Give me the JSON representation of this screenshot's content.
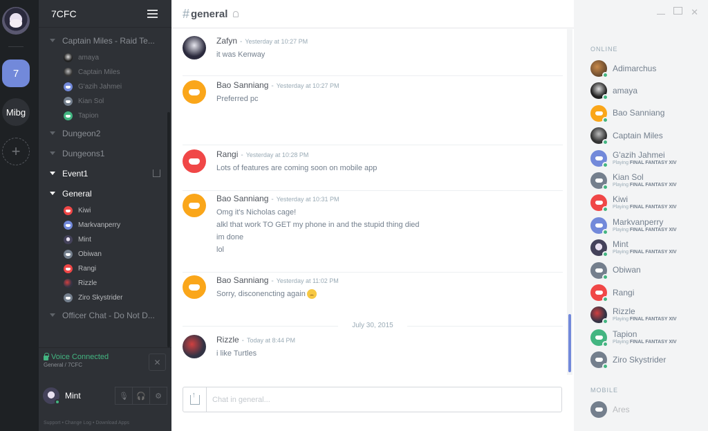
{
  "guilds": [
    {
      "id": "avatar",
      "label": ""
    },
    {
      "id": "7",
      "label": "7"
    },
    {
      "id": "mibg",
      "label": "Mibg"
    },
    {
      "id": "add",
      "label": "+"
    }
  ],
  "server": {
    "name": "7CFC"
  },
  "channels": {
    "captain": {
      "label": "Captain Miles - Raid Te...",
      "users": [
        "amaya",
        "Captain Miles",
        "G'azih Jahmei",
        "Kian Sol",
        "Tapion"
      ]
    },
    "dungeon2": {
      "label": "Dungeon2"
    },
    "dungeons1": {
      "label": "Dungeons1"
    },
    "event1": {
      "label": "Event1"
    },
    "general": {
      "label": "General",
      "users": [
        "Kiwi",
        "Markvanperry",
        "Mint",
        "Obiwan",
        "Rangi",
        "Rizzle",
        "Ziro Skystrider"
      ]
    },
    "officer": {
      "label": "Officer Chat - Do Not D..."
    }
  },
  "voice": {
    "status": "Voice Connected",
    "channel": "General / 7CFC"
  },
  "user": {
    "name": "Mint"
  },
  "footer": {
    "links": "Support  •  Change Log  •  Download Apps"
  },
  "chat": {
    "hash": "#",
    "channel": "general",
    "messages": [
      {
        "author": "Zafyn",
        "time": "Yesterday at 10:27 PM",
        "lines": [
          "it was Kenway"
        ]
      },
      {
        "author": "Bao Sanniang",
        "time": "Yesterday at 10:27 PM",
        "lines": [
          "Preferred pc"
        ]
      },
      {
        "author": "Rangi",
        "time": "Yesterday at 10:28 PM",
        "lines": [
          "Lots of features are coming soon on mobile app"
        ]
      },
      {
        "author": "Bao Sanniang",
        "time": "Yesterday at 10:31 PM",
        "lines": [
          "Omg it's Nicholas cage!",
          "alkl that work TO GET my phone in and the stupid thing died",
          "im done",
          "lol"
        ]
      },
      {
        "author": "Bao Sanniang",
        "time": "Yesterday at 11:02 PM",
        "lines": [
          "Sorry, disconencting again"
        ]
      },
      {
        "author": "Rizzle",
        "time": "Today at 8:44 PM",
        "lines": [
          "i like Turtles"
        ]
      }
    ],
    "date_divider": "July 30, 2015",
    "dash": "-",
    "input_placeholder": "Chat in general..."
  },
  "members": {
    "online_heading": "ONLINE",
    "mobile_heading": "MOBILE",
    "playing_prefix": "Playing",
    "game": "FINAL FANTASY XIV",
    "online": [
      {
        "name": "Adimarchus",
        "playing": false
      },
      {
        "name": "amaya",
        "playing": false
      },
      {
        "name": "Bao Sanniang",
        "playing": false
      },
      {
        "name": "Captain Miles",
        "playing": false
      },
      {
        "name": "G'azih Jahmei",
        "playing": true
      },
      {
        "name": "Kian Sol",
        "playing": true
      },
      {
        "name": "Kiwi",
        "playing": true
      },
      {
        "name": "Markvanperry",
        "playing": true
      },
      {
        "name": "Mint",
        "playing": true
      },
      {
        "name": "Obiwan",
        "playing": false
      },
      {
        "name": "Rangi",
        "playing": false
      },
      {
        "name": "Rizzle",
        "playing": true
      },
      {
        "name": "Tapion",
        "playing": true
      },
      {
        "name": "Ziro Skystrider",
        "playing": false
      }
    ],
    "mobile": [
      {
        "name": "Ares"
      }
    ]
  },
  "colors": {
    "brand": "#7289da",
    "online": "#43b581",
    "orange": "#faa61a",
    "red": "#f04747",
    "green": "#43b581",
    "grey": "#747f8d"
  }
}
